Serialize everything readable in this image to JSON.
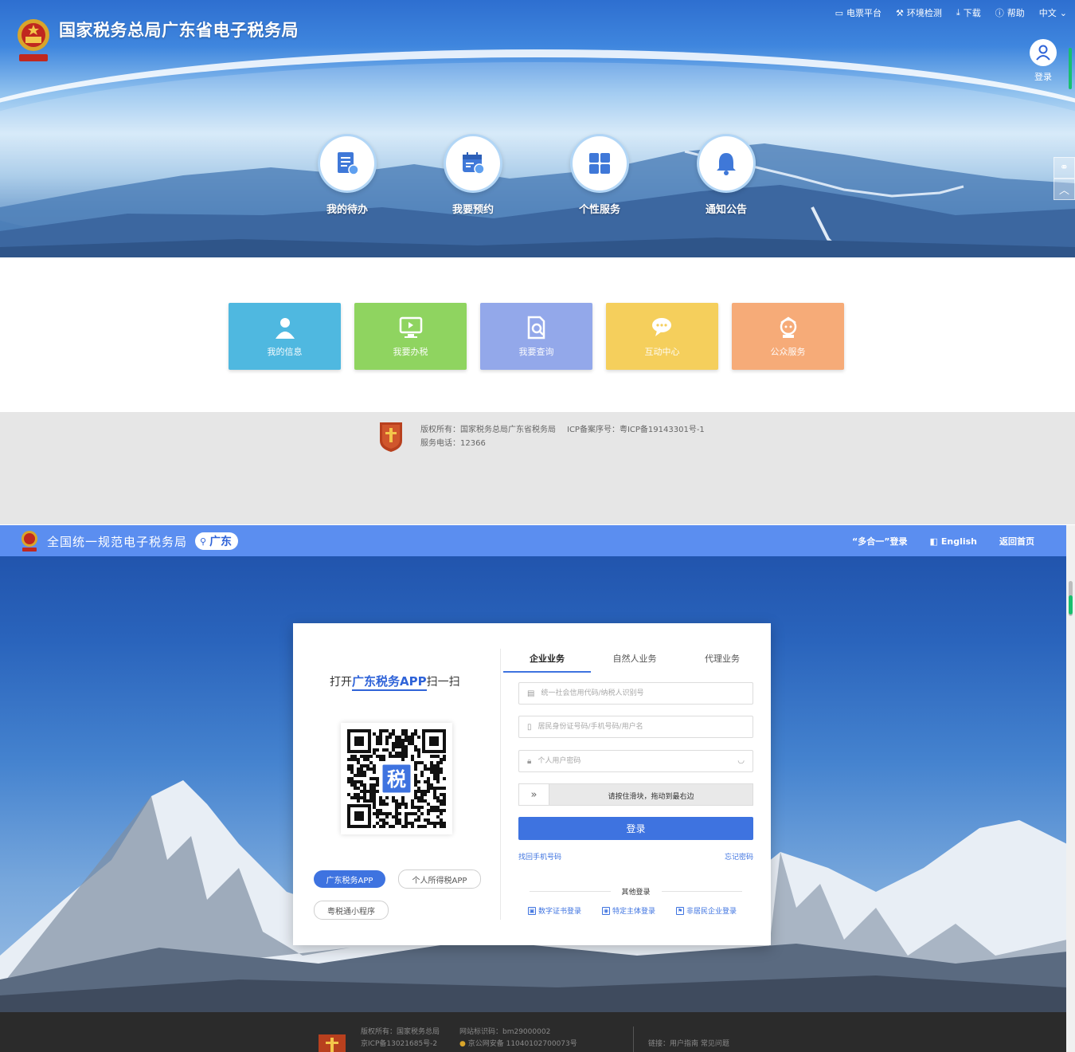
{
  "portal": {
    "brand_title": "国家税务总局广东省电子税务局",
    "topnav": [
      {
        "icon": "monitor-icon",
        "label": "电票平台"
      },
      {
        "icon": "wrench-icon",
        "label": "环境检测"
      },
      {
        "icon": "download-icon",
        "label": "下载"
      },
      {
        "icon": "help-icon",
        "label": "帮助"
      },
      {
        "icon": "chevron-down-icon",
        "label": "中文"
      }
    ],
    "login_label": "登录",
    "features": [
      {
        "icon": "todo-list-icon",
        "label": "我的待办"
      },
      {
        "icon": "calendar-appointment-icon",
        "label": "我要预约"
      },
      {
        "icon": "grid-apps-icon",
        "label": "个性服务"
      },
      {
        "icon": "bell-icon",
        "label": "通知公告"
      }
    ],
    "tiles": [
      {
        "icon": "user-icon",
        "label": "我的信息",
        "color": "#4fb8e0"
      },
      {
        "icon": "monitor-tax-icon",
        "label": "我要办税",
        "color": "#8fd460"
      },
      {
        "icon": "doc-search-icon",
        "label": "我要查询",
        "color": "#93a8ea"
      },
      {
        "icon": "chat-icon",
        "label": "互动中心",
        "color": "#f5cf5c"
      },
      {
        "icon": "service-icon",
        "label": "公众服务",
        "color": "#f6ab78"
      }
    ],
    "footer": {
      "copyright": "版权所有：国家税务总局广东省税务局",
      "icp": "ICP备案序号：粤ICP备19143301号-1",
      "phone": "服务电话：12366"
    }
  },
  "login": {
    "site_title": "全国统一规范电子税务局",
    "region": "广东",
    "nav": [
      {
        "label": "“多合一”登录"
      },
      {
        "label": "English"
      },
      {
        "label": "返回首页"
      }
    ],
    "qr": {
      "prefix": "打开",
      "app_name": "广东税务APP",
      "suffix": "扫一扫",
      "center_char": "税"
    },
    "app_buttons": [
      {
        "label": "广东税务APP",
        "active": true
      },
      {
        "label": "个人所得税APP",
        "active": false
      },
      {
        "label": "粤税通小程序",
        "active": false
      }
    ],
    "tabs": [
      "企业业务",
      "自然人业务",
      "代理业务"
    ],
    "fields": {
      "credit_code_placeholder": "统一社会信用代码/纳税人识别号",
      "id_placeholder": "居民身份证号码/手机号码/用户名",
      "password_placeholder": "个人用户密码"
    },
    "slider_text": "请按住滑块，拖动到最右边",
    "login_button": "登录",
    "forgot_phone": "找回手机号码",
    "forgot_password": "忘记密码",
    "other_login_title": "其他登录",
    "other_links": [
      {
        "label": "数字证书登录"
      },
      {
        "label": "特定主体登录"
      },
      {
        "label": "非居民企业登录"
      }
    ],
    "footer": {
      "copyright": "版权所有：国家税务总局",
      "icp": "京ICP备13021685号-2",
      "site_id": "网站标识码：bm29000002",
      "police": "京公网安备 11040102700073号",
      "links": "链接：用户指南   常见问题"
    }
  }
}
